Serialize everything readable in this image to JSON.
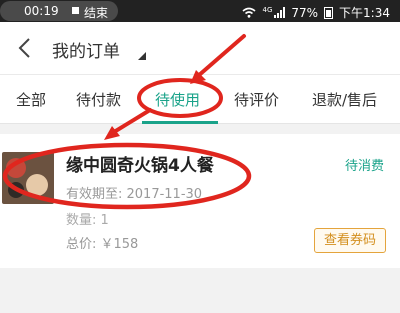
{
  "statusbar": {
    "time": "00:19",
    "end_label": "结束",
    "network": "4G",
    "battery": "77%",
    "clock": "下午1:34"
  },
  "header": {
    "title": "我的订单"
  },
  "tabs": [
    {
      "label": "全部"
    },
    {
      "label": "待付款"
    },
    {
      "label": "待使用"
    },
    {
      "label": "待评价"
    },
    {
      "label": "退款/售后"
    }
  ],
  "active_tab": "待使用",
  "order": {
    "name": "缘中圆奇火锅4人餐",
    "status": "待消费",
    "valid_until": "有效期至: 2017-11-30",
    "quantity": "数量: 1",
    "total": "总价: ￥158",
    "action_label": "查看券码"
  },
  "colors": {
    "accent": "#1aa38a",
    "annotation": "#e0261e",
    "button_border": "#e4a43c"
  },
  "icons": {
    "back": "back-arrow-icon",
    "wifi": "wifi-icon",
    "signal": "signal-icon",
    "battery": "battery-icon"
  }
}
